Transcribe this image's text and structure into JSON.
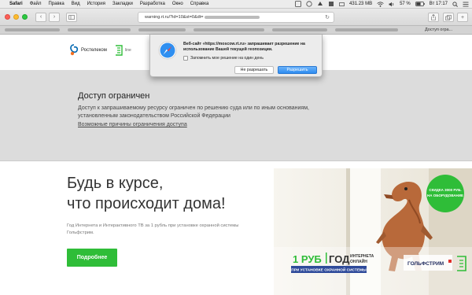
{
  "menubar": {
    "app": "Safari",
    "items": [
      "Файл",
      "Правка",
      "Вид",
      "История",
      "Закладки",
      "Разработка",
      "Окно",
      "Справка"
    ],
    "memory": "431.23 MB",
    "battery": "57 %",
    "clock": "Вт 17:17"
  },
  "browser": {
    "address": "warning.rt.ru/?id=10&st=0&dt=",
    "tab_active": "Доступ огра..."
  },
  "site": {
    "brand": "Ростелеком",
    "partner": "line"
  },
  "permission_dialog": {
    "message": "Веб-сайт «https://moscow.rt.ru» запрашивает разрешение на использование Вашей текущей геопозиции.",
    "checkbox_label": "Запомнить мое решение на один день",
    "deny_label": "Не разрешать",
    "allow_label": "Разрешить"
  },
  "access": {
    "title": "Доступ ограничен",
    "body": "Доступ к запрашиваемому ресурсу ограничен по решению суда или по иным основаниям, установленным законодательством Российской Федерации",
    "link": "Возможные причины ограничения доступа"
  },
  "banner": {
    "headline_1": "Будь в курсе,",
    "headline_2": "что происходит дома!",
    "text": "Год Интернета и Интерактивного ТВ за 1 рубль при установке охранной системы Гольфстрим.",
    "button": "Подробнее",
    "badge": "СКИДКА 3000 РУБ. НА ОБОРУДОВАНИЕ",
    "promo_price": "1 РУБ",
    "promo_year": "ГОД",
    "promo_sub1": "ИНТЕРНЕТА",
    "promo_sub2": "ОНЛАЙН",
    "promo_caption": "ПРИ УСТАНОВКЕ ОХРАННОЙ СИСТЕМЫ",
    "golfstream": "ГОЛЬФСТРИМ"
  },
  "colors": {
    "rt_orange": "#f36f21",
    "rt_blue": "#0067b1",
    "green": "#2fbd38",
    "safari_blue": "#2d8cf0"
  }
}
